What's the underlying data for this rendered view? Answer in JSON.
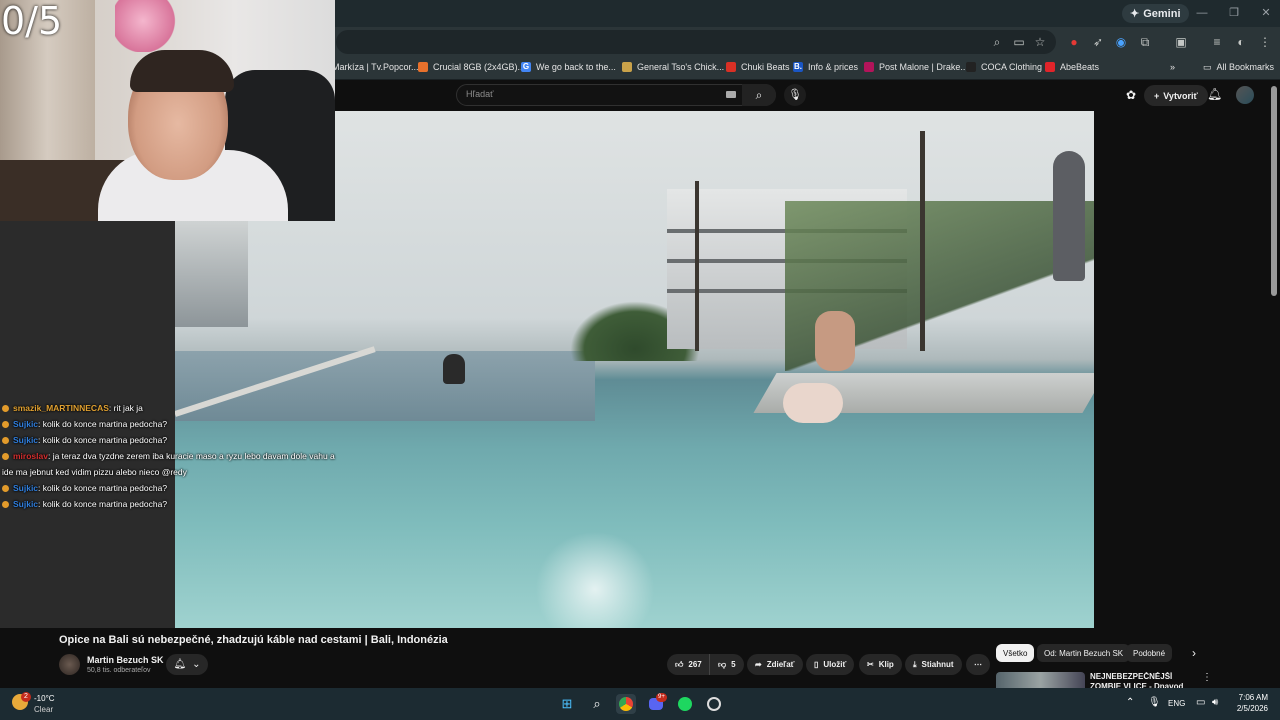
{
  "browser": {
    "gemini_label": "Gemini",
    "bookmarks": [
      {
        "label": "Markíza | Tv.Popcor...",
        "color": "#1f8fd6"
      },
      {
        "label": "Crucial 8GB (2x4GB)...",
        "color": "#e8712c"
      },
      {
        "label": "We go back to the...",
        "color": "#4285f4",
        "glyph": "G"
      },
      {
        "label": "General Tso's Chick...",
        "color": "#c9a24a"
      },
      {
        "label": "Chuki Beats",
        "color": "#d93025"
      },
      {
        "label": "Info & prices",
        "color": "#1a56c4",
        "glyph": "B."
      },
      {
        "label": "Post Malone | Drake...",
        "color": "#b3145a"
      },
      {
        "label": "COCA Clothing",
        "color": "#222222"
      },
      {
        "label": "AbeBeats",
        "color": "#e1242a"
      }
    ],
    "more_bookmarks_icon": "double-chevron-icon",
    "all_bookmarks_label": "All Bookmarks"
  },
  "youtube": {
    "search_placeholder": "Hľadať",
    "create_label": "Vytvoriť",
    "video_title": "Opice na Bali sú nebezpečné, zhadzujú káble nad cestami | Bali, Indonézia",
    "channel_name": "Martin Bezuch SK",
    "channel_subs": "50,8 tis. odberateľov",
    "likes": "267",
    "dislikes": "5",
    "share_label": "Zdieľať",
    "save_label": "Uložiť",
    "clip_label": "Klip",
    "download_label": "Stiahnut",
    "chips": [
      "Všetko",
      "Od: Martin Bezuch SK",
      "Podobné"
    ],
    "rec_title": "NEJNEBEZPEČNĚJŠÍ ZOMBIE VLICE - Dnavod Ochrozená"
  },
  "overlay": {
    "counter": "0/5",
    "chat": [
      {
        "user": "smazik_MARTINNECAS",
        "user_color": "#e0a030",
        "message": ": rit jak ja"
      },
      {
        "user": "Sujkic",
        "user_color": "#2f7ddb",
        "message": ": kolik do konce martina pedocha?"
      },
      {
        "user": "Sujkic",
        "user_color": "#2f7ddb",
        "message": ": kolik do konce martina pedocha?"
      },
      {
        "user": "miroslav",
        "user_color": "#d22e2e",
        "message": ": ja teraz dva tyzdne zerem iba kuracie maso a ryzu lebo davam dole vahu a"
      },
      {
        "user": "",
        "user_color": "#ffffff",
        "message": "ide ma jebnut ked vidim pizzu alebo nieco @redy"
      },
      {
        "user": "Sujkic",
        "user_color": "#2f7ddb",
        "message": ": kolik do konce martina pedocha?"
      },
      {
        "user": "Sujkic",
        "user_color": "#2f7ddb",
        "message": ": kolik do konce martina pedocha?"
      }
    ]
  },
  "taskbar": {
    "weather_temp": "-10°C",
    "weather_desc": "Clear",
    "weather_badge": "2",
    "discord_badge": "9+",
    "language": "ENG",
    "time": "7:06 AM",
    "date": "2/5/2026"
  }
}
